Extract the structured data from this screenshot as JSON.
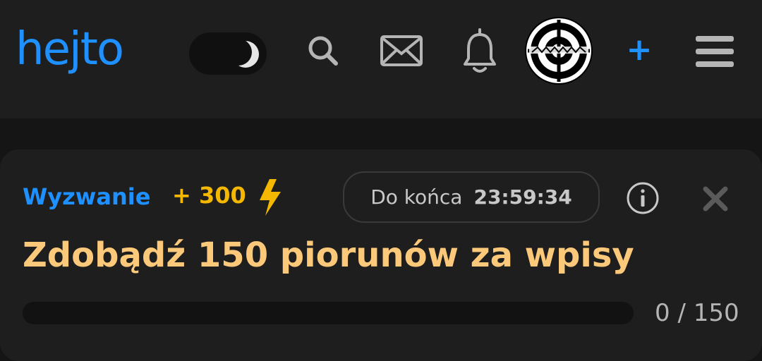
{
  "header": {
    "logo_text": "hejto",
    "icons": {
      "theme_toggle": "moon-icon",
      "search": "search-icon",
      "messages": "mail-icon",
      "notifications": "bell-icon",
      "add": "plus-icon",
      "menu": "menu-icon"
    },
    "add_label": "+",
    "colors": {
      "brand": "#1e90ff",
      "bar_bg": "#1e1e1e"
    }
  },
  "challenge": {
    "label": "Wyzwanie",
    "reward": "+ 300",
    "reward_icon": "lightning-icon",
    "timer_label": "Do końca",
    "timer_value": "23:59:34",
    "title": "Zdobądź 150 piorunów za wpisy",
    "progress": {
      "current": 0,
      "total": 150,
      "text": "0 / 150",
      "fraction": 0
    },
    "colors": {
      "label": "#1e90ff",
      "reward": "#f5b800",
      "title": "#fcc97a"
    }
  }
}
